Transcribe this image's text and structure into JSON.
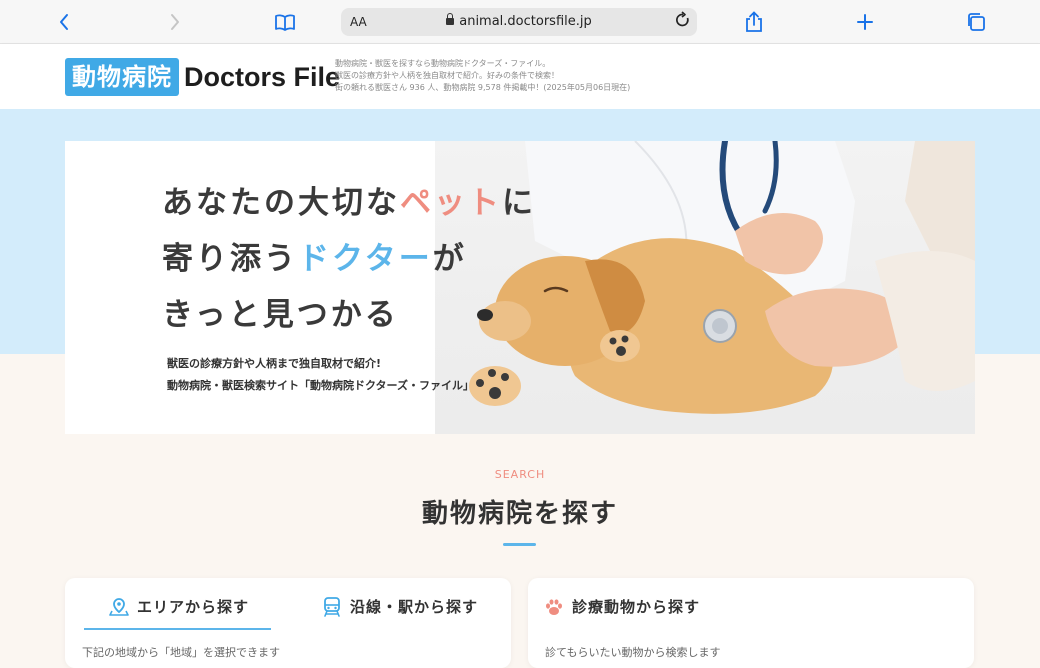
{
  "browser": {
    "text_size_label": "AA",
    "url": "animal.doctorsfile.jp"
  },
  "header": {
    "logo_jp": "動物病院",
    "logo_en": "Doctors File",
    "tagline": [
      "動物病院・獣医を探すなら動物病院ドクターズ・ファイル。",
      "獣医の診療方針や人柄を独自取材で紹介。好みの条件で検索！",
      "街の頼れる獣医さん 936 人、動物病院 9,578 件掲載中！(2025年05月06日現在)"
    ]
  },
  "hero": {
    "line1_a": "あなたの大切な",
    "line1_b": "ペット",
    "line1_c": "に",
    "line2_a": "寄り添う",
    "line2_b": "ドクター",
    "line2_c": "が",
    "line3": "きっと見つかる",
    "sub1": "獣医の診療方針や人柄まで独自取材で紹介!",
    "sub2": "動物病院・獣医検索サイト「動物病院ドクターズ・ファイル」"
  },
  "search": {
    "label": "SEARCH",
    "title": "動物病院を探す",
    "tabs": [
      {
        "label": "エリアから探す",
        "icon": "map-pin-icon"
      },
      {
        "label": "沿線・駅から探す",
        "icon": "train-icon"
      },
      {
        "label": "診療動物から探す",
        "icon": "paw-icon"
      }
    ],
    "left_desc": "下記の地域から「地域」を選択できます",
    "right_desc": "診てもらいたい動物から検索します"
  },
  "colors": {
    "brand_blue": "#40a9e6",
    "accent_pink": "#ef8d80",
    "accent_blue": "#5cb5ea",
    "hero_bg": "#d3ecfb",
    "page_bg": "#fbf6f1"
  }
}
